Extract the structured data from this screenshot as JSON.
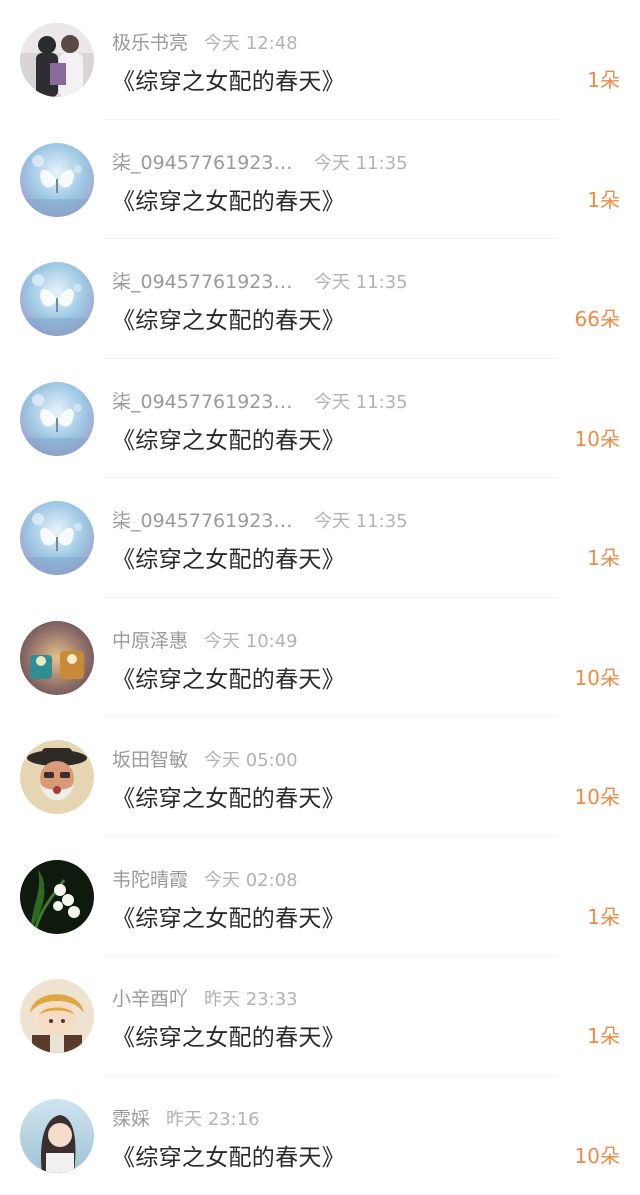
{
  "gift_list": {
    "items": [
      {
        "name": "极乐书亮",
        "time": "今天 12:48",
        "book_title": "《综穿之女配的春天》",
        "amount": "1朵",
        "avatar": "avatar-couple-photo"
      },
      {
        "name": "柒_094577619239...",
        "time": "今天 11:35",
        "book_title": "《综穿之女配的春天》",
        "amount": "1朵",
        "avatar": "avatar-butterfly"
      },
      {
        "name": "柒_094577619239...",
        "time": "今天 11:35",
        "book_title": "《综穿之女配的春天》",
        "amount": "66朵",
        "avatar": "avatar-butterfly"
      },
      {
        "name": "柒_094577619239...",
        "time": "今天 11:35",
        "book_title": "《综穿之女配的春天》",
        "amount": "10朵",
        "avatar": "avatar-butterfly"
      },
      {
        "name": "柒_094577619239...",
        "time": "今天 11:35",
        "book_title": "《综穿之女配的春天》",
        "amount": "1朵",
        "avatar": "avatar-butterfly"
      },
      {
        "name": "中原泽惠",
        "time": "今天 10:49",
        "book_title": "《综穿之女配的春天》",
        "amount": "10朵",
        "avatar": "avatar-candles"
      },
      {
        "name": "坂田智敏",
        "time": "今天 05:00",
        "book_title": "《综穿之女配的春天》",
        "amount": "10朵",
        "avatar": "avatar-bearded-man"
      },
      {
        "name": "韦陀晴霞",
        "time": "今天 02:08",
        "book_title": "《综穿之女配的春天》",
        "amount": "1朵",
        "avatar": "avatar-lily-of-valley"
      },
      {
        "name": "小辛酉吖",
        "time": "昨天 23:33",
        "book_title": "《综穿之女配的春天》",
        "amount": "1朵",
        "avatar": "avatar-anime-character"
      },
      {
        "name": "霂婇",
        "time": "昨天 23:16",
        "book_title": "《综穿之女配的春天》",
        "amount": "10朵",
        "avatar": "avatar-girl-portrait"
      }
    ]
  },
  "colors": {
    "amount": "#f08a45",
    "name": "#9a9a9a",
    "time": "#b3b3b3",
    "title": "#2a2a2a",
    "divider": "#f3f3f3"
  }
}
